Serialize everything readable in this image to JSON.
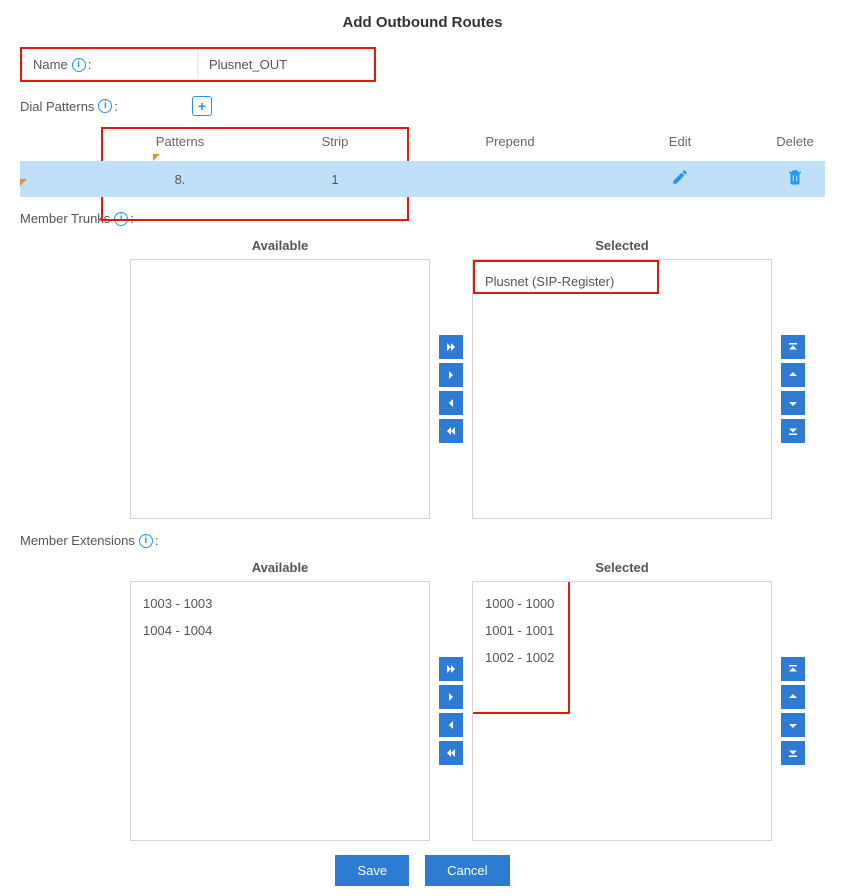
{
  "title": "Add Outbound Routes",
  "name": {
    "label": "Name",
    "value": "Plusnet_OUT"
  },
  "dialPatterns": {
    "label": "Dial Patterns",
    "cols": {
      "patterns": "Patterns",
      "strip": "Strip",
      "prepend": "Prepend",
      "edit": "Edit",
      "delete": "Delete"
    },
    "rows": [
      {
        "pattern": "8.",
        "strip": "1",
        "prepend": ""
      }
    ]
  },
  "memberTrunks": {
    "label": "Member Trunks",
    "availableLabel": "Available",
    "selectedLabel": "Selected",
    "available": [],
    "selected": [
      "Plusnet (SIP-Register)"
    ]
  },
  "memberExtensions": {
    "label": "Member Extensions",
    "availableLabel": "Available",
    "selectedLabel": "Selected",
    "available": [
      "1003 - 1003",
      "1004 - 1004"
    ],
    "selected": [
      "1000 - 1000",
      "1001 - 1001",
      "1002 - 1002"
    ]
  },
  "buttons": {
    "save": "Save",
    "cancel": "Cancel"
  }
}
